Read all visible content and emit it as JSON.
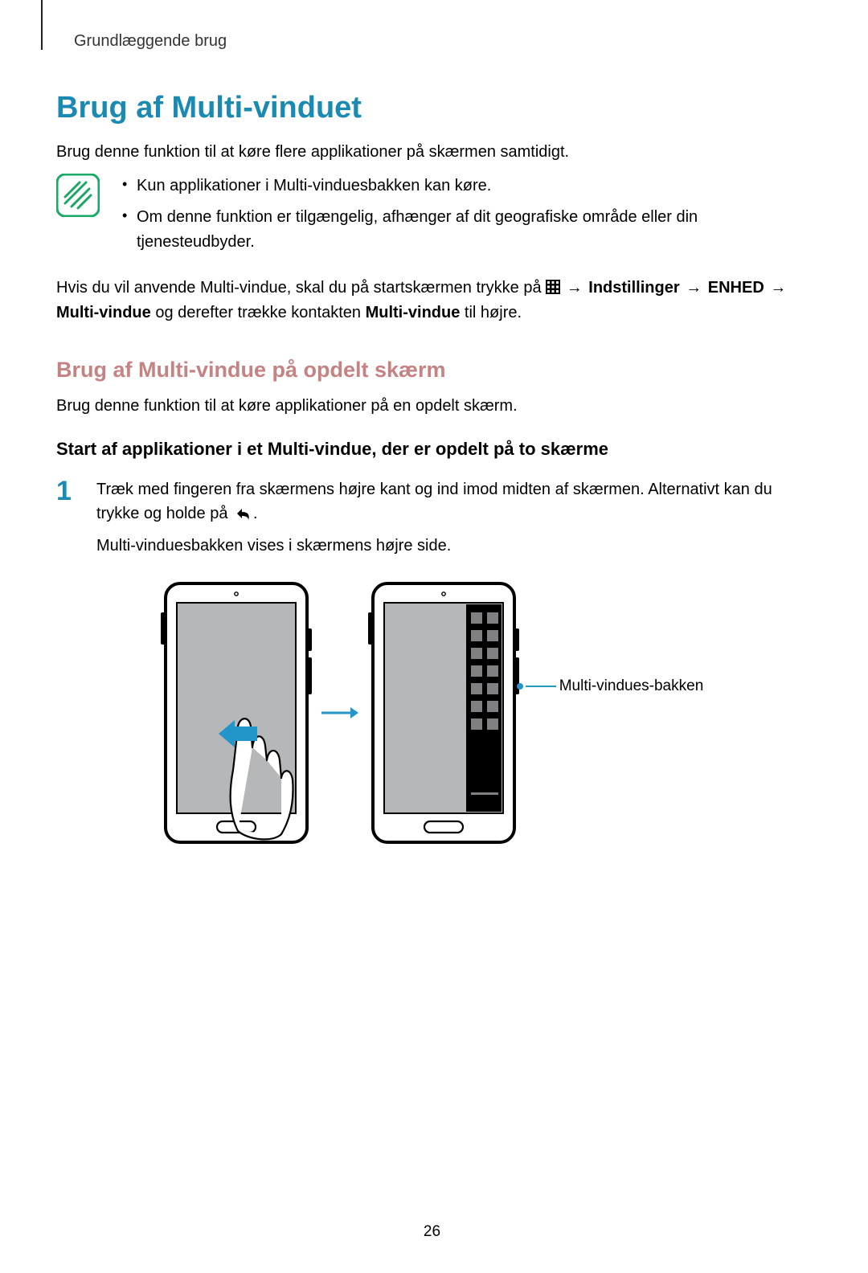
{
  "header": "Grundlæggende brug",
  "h1": "Brug af Multi-vinduet",
  "intro": "Brug denne funktion til at køre flere applikationer på skærmen samtidigt.",
  "notes": [
    "Kun applikationer i Multi-vinduesbakken kan køre.",
    "Om denne funktion er tilgængelig, afhænger af dit geografiske område eller din tjenesteudbyder."
  ],
  "settings": {
    "pre": "Hvis du vil anvende Multi-vindue, skal du på startskærmen trykke på ",
    "arrow": " → ",
    "indstillinger": "Indstillinger",
    "enhed": "ENHED",
    "multivindue": "Multi-vindue",
    "mid": " og derefter trække kontakten ",
    "tail": " til højre."
  },
  "h2": "Brug af Multi-vindue på opdelt skærm",
  "h2_body": "Brug denne funktion til at køre applikationer på en opdelt skærm.",
  "h3": "Start af applikationer i et Multi-vindue, der er opdelt på to skærme",
  "steps": {
    "1": {
      "num": "1",
      "line1a": "Træk med fingeren fra skærmens højre kant og ind imod midten af skærmen. Alternativt kan du trykke og holde på ",
      "line1b": ".",
      "line2": "Multi-vinduesbakken vises i skærmens højre side."
    }
  },
  "callout": "Multi-vindues-bakken",
  "pagenum": "26"
}
